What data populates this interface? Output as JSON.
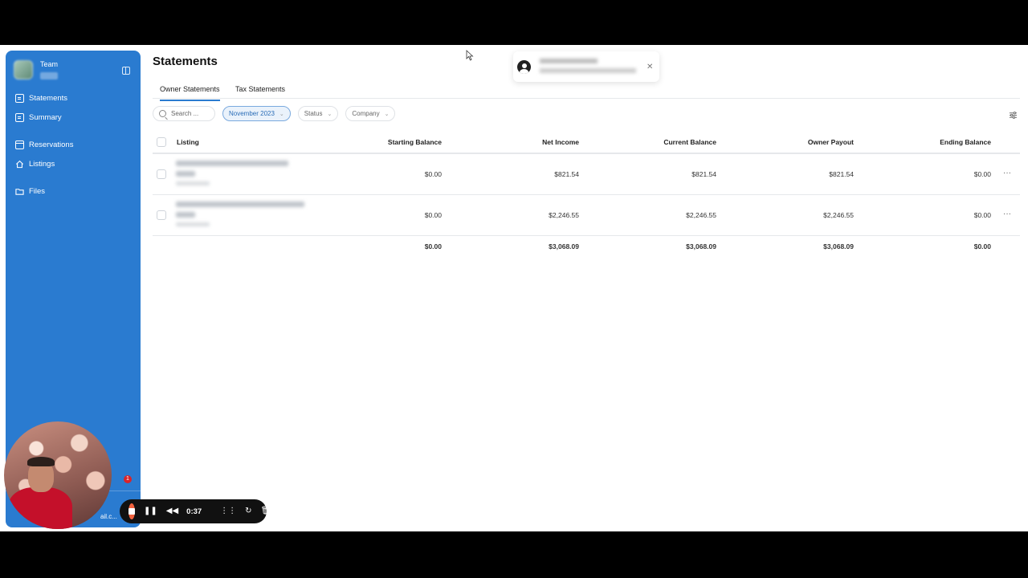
{
  "sidebar": {
    "team_name": "Team",
    "items": [
      {
        "label": "Statements",
        "icon": "document-icon"
      },
      {
        "label": "Summary",
        "icon": "document-icon"
      },
      {
        "label": "Reservations",
        "icon": "calendar-icon"
      },
      {
        "label": "Listings",
        "icon": "home-icon"
      },
      {
        "label": "Files",
        "icon": "folder-icon"
      }
    ],
    "notification_count": "1",
    "email_fragment": "ail.c..."
  },
  "page": {
    "title": "Statements"
  },
  "tabs": [
    {
      "label": "Owner Statements",
      "active": true
    },
    {
      "label": "Tax Statements",
      "active": false
    }
  ],
  "filters": {
    "search_placeholder": "Search ...",
    "period": "November 2023",
    "status": "Status",
    "company": "Company"
  },
  "table": {
    "columns": [
      "Listing",
      "Starting Balance",
      "Net Income",
      "Current Balance",
      "Owner Payout",
      "Ending Balance"
    ],
    "rows": [
      {
        "starting_balance": "$0.00",
        "net_income": "$821.54",
        "current_balance": "$821.54",
        "owner_payout": "$821.54",
        "ending_balance": "$0.00"
      },
      {
        "starting_balance": "$0.00",
        "net_income": "$2,246.55",
        "current_balance": "$2,246.55",
        "owner_payout": "$2,246.55",
        "ending_balance": "$0.00"
      }
    ],
    "totals": {
      "starting_balance": "$0.00",
      "net_income": "$3,068.09",
      "current_balance": "$3,068.09",
      "owner_payout": "$3,068.09",
      "ending_balance": "$0.00"
    }
  },
  "recorder": {
    "time": "0:37",
    "stop_color": "#f2613d"
  },
  "colors": {
    "sidebar": "#2a7bd0",
    "accent": "#2a7bd0"
  }
}
